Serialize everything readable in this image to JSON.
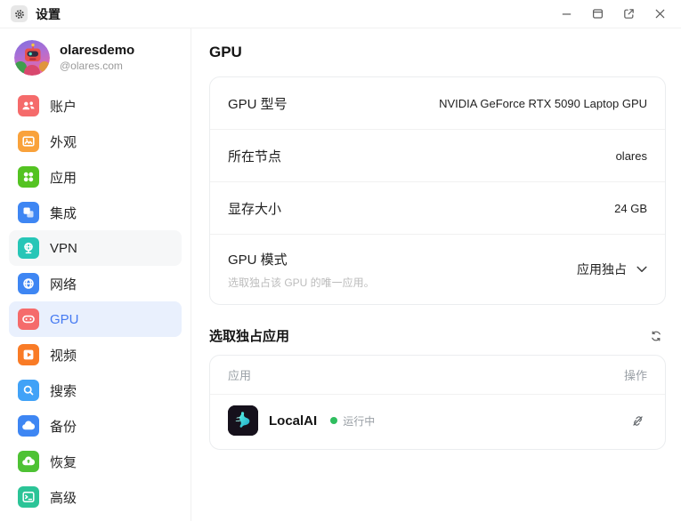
{
  "colors": {
    "accent": "#4479F2",
    "selected_bg": "#E9F0FD",
    "status_green": "#2FBE5F"
  },
  "titlebar": {
    "title": "设置"
  },
  "sidebar": {
    "user": {
      "name": "olaresdemo",
      "handle": "@olares.com"
    },
    "items": [
      {
        "label": "账户",
        "icon": "users-icon",
        "color": "#F56B6B"
      },
      {
        "label": "外观",
        "icon": "image-icon",
        "color": "#F9A23B"
      },
      {
        "label": "应用",
        "icon": "apps-icon",
        "color": "#54C322"
      },
      {
        "label": "集成",
        "icon": "overlap-squares-icon",
        "color": "#3E86F3"
      },
      {
        "label": "VPN",
        "icon": "globe-stand-icon",
        "color": "#27C6B7"
      },
      {
        "label": "网络",
        "icon": "globe-icon",
        "color": "#3E86F3"
      },
      {
        "label": "GPU",
        "icon": "gpu-goggles-icon",
        "color": "#F56B6B"
      },
      {
        "label": "视频",
        "icon": "video-play-icon",
        "color": "#F97B26"
      },
      {
        "label": "搜索",
        "icon": "magnifier-icon",
        "color": "#41A2F7"
      },
      {
        "label": "备份",
        "icon": "cloud-icon",
        "color": "#3E86F3"
      },
      {
        "label": "恢复",
        "icon": "cloud-restore-icon",
        "color": "#4EC234"
      },
      {
        "label": "高级",
        "icon": "terminal-icon",
        "color": "#2BC497"
      }
    ]
  },
  "main": {
    "title": "GPU",
    "info_rows": [
      {
        "label": "GPU 型号",
        "value": "NVIDIA GeForce RTX 5090 Laptop GPU"
      },
      {
        "label": "所在节点",
        "value": "olares"
      },
      {
        "label": "显存大小",
        "value": "24 GB"
      }
    ],
    "mode_row": {
      "label": "GPU 模式",
      "sublabel": "选取独占该 GPU 的唯一应用。",
      "value": "应用独占"
    },
    "apps_section": {
      "title": "选取独占应用",
      "col_app": "应用",
      "col_action": "操作",
      "rows": [
        {
          "name": "LocalAI",
          "status": "运行中"
        }
      ]
    }
  }
}
